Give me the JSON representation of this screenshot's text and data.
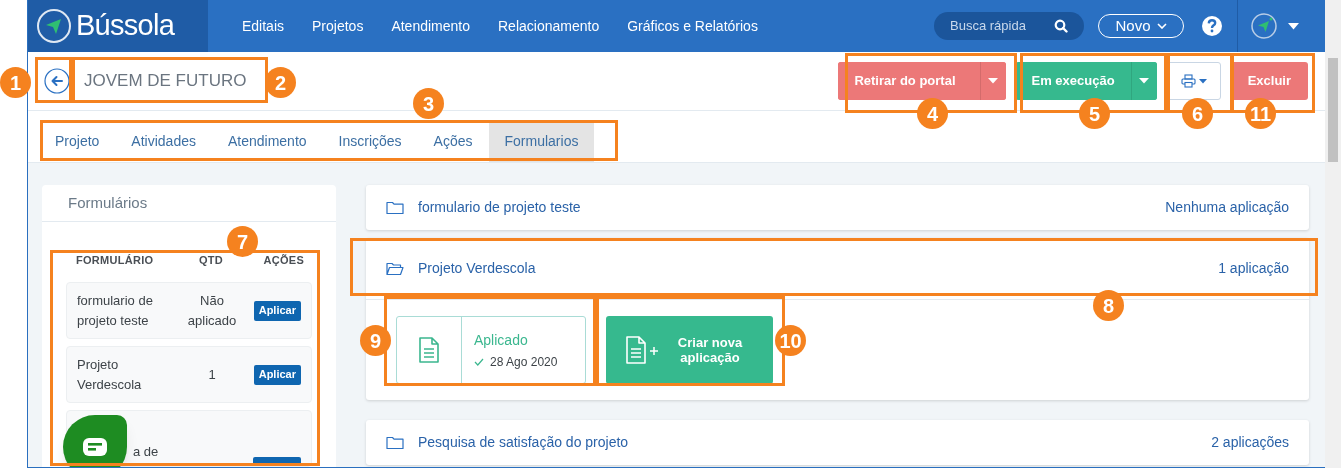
{
  "brand": {
    "name": "Bússola"
  },
  "nav": [
    {
      "label": "Editais"
    },
    {
      "label": "Projetos"
    },
    {
      "label": "Atendimento"
    },
    {
      "label": "Relacionamento"
    },
    {
      "label": "Gráficos e Relatórios"
    }
  ],
  "search": {
    "placeholder": "Busca rápida"
  },
  "new_button": {
    "label": "Novo"
  },
  "page": {
    "title": "JOVEM DE FUTURO"
  },
  "actions": [
    {
      "kind": "split",
      "label": "Retirar do portal",
      "color": "#ec7878"
    },
    {
      "kind": "split",
      "label": "Em execução",
      "color": "#36b98e"
    },
    {
      "kind": "print"
    },
    {
      "kind": "plain",
      "label": "Excluir",
      "color": "#ec7878"
    }
  ],
  "tabs": [
    {
      "label": "Projeto",
      "selected": false
    },
    {
      "label": "Atividades",
      "selected": false
    },
    {
      "label": "Atendimento",
      "selected": false
    },
    {
      "label": "Inscrições",
      "selected": false
    },
    {
      "label": "Ações",
      "selected": false
    },
    {
      "label": "Formularios",
      "selected": true
    }
  ],
  "sidebar": {
    "title": "Formulários",
    "columns": [
      "FORMULÁRIO",
      "QTD",
      "AÇÕES"
    ],
    "rows": [
      {
        "name": "formulario de projeto teste",
        "qtd": "Não aplicado",
        "action": "Aplicar"
      },
      {
        "name": "Projeto Verdescola",
        "qtd": "1",
        "action": "Aplicar"
      },
      {
        "name": "a de"
      }
    ]
  },
  "forms": [
    {
      "name": "formulario de projeto teste",
      "count": "Nenhuma aplicação",
      "expanded": false
    },
    {
      "name": "Projeto Verdescola",
      "count": "1 aplicação",
      "expanded": true,
      "applications": [
        {
          "status": "Aplicado",
          "date": "28 Ago 2020"
        }
      ],
      "create_label": "Criar nova aplicação"
    },
    {
      "name": "Pesquisa de satisfação do projeto",
      "count": "2 aplicações",
      "expanded": false
    }
  ],
  "callouts": [
    {
      "number": "1"
    },
    {
      "number": "2"
    },
    {
      "number": "3"
    },
    {
      "number": "4"
    },
    {
      "number": "5"
    },
    {
      "number": "6"
    },
    {
      "number": "11"
    },
    {
      "number": "7"
    },
    {
      "number": "8"
    },
    {
      "number": "9"
    },
    {
      "number": "10"
    }
  ]
}
